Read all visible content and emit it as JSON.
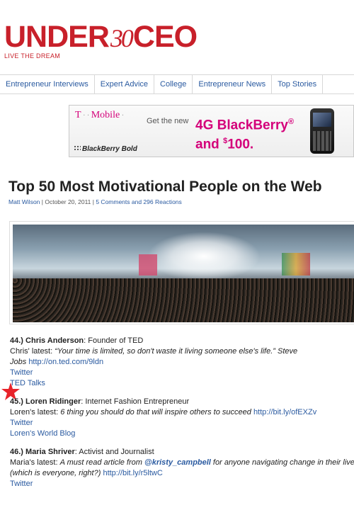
{
  "brand": {
    "name_part1": "UNDER",
    "name_num": "30",
    "name_part2": "CEO",
    "tagline": "LIVE THE DREAM",
    "color": "#c8202a"
  },
  "nav": {
    "items": [
      {
        "label": "Entrepreneur Interviews"
      },
      {
        "label": "Expert Advice"
      },
      {
        "label": "College"
      },
      {
        "label": "Entrepreneur News"
      },
      {
        "label": "Top Stories"
      }
    ]
  },
  "ad": {
    "carrier": "T",
    "carrier_suffix": "Mobile",
    "get_new": "Get the new",
    "promo_line1": "4G BlackBerry",
    "promo_reg": "®",
    "promo_line2_prefix": "and ",
    "promo_dollar": "$",
    "promo_amount": "100.",
    "product": "BlackBerry Bold",
    "accent": "#d4007a"
  },
  "article": {
    "title": "Top 50 Most Motivational People on the Web",
    "author": "Matt Wilson",
    "date": "October 20, 2011",
    "comments": "5 Comments and 296 Reactions"
  },
  "entries": [
    {
      "number": "44.)",
      "name": "Chris Anderson",
      "role": ": Founder of TED",
      "latest_prefix": "Chris' latest: ",
      "quote": "“Your time is limited, so don't waste it living someone else's life.” Steve",
      "quote2": "Jobs",
      "link": "http://on.ted.com/9ldn",
      "links": [
        "Twitter",
        "TED Talks"
      ]
    },
    {
      "number": "45.)",
      "name": "Loren Ridinger",
      "role": ": Internet Fashion Entrepreneur",
      "latest_prefix": "Loren's latest: ",
      "quote": "6 thing you should do that will inspire others to succeed",
      "link": "http://bit.ly/ofEXZv",
      "links": [
        "Twitter",
        "Loren's World Blog"
      ]
    },
    {
      "number": "46.)",
      "name": "Maria Shriver",
      "role": ": Activist and Journalist",
      "latest_prefix": "Maria's latest: ",
      "quote": "A must read article from ",
      "mention": "@kristy_campbell",
      "quote_cont": " for anyone navigating change in their lives",
      "quote2": "(which is everyone, right?)",
      "link": "http://bit.ly/r5ltwC",
      "links": [
        "Twitter"
      ]
    }
  ]
}
